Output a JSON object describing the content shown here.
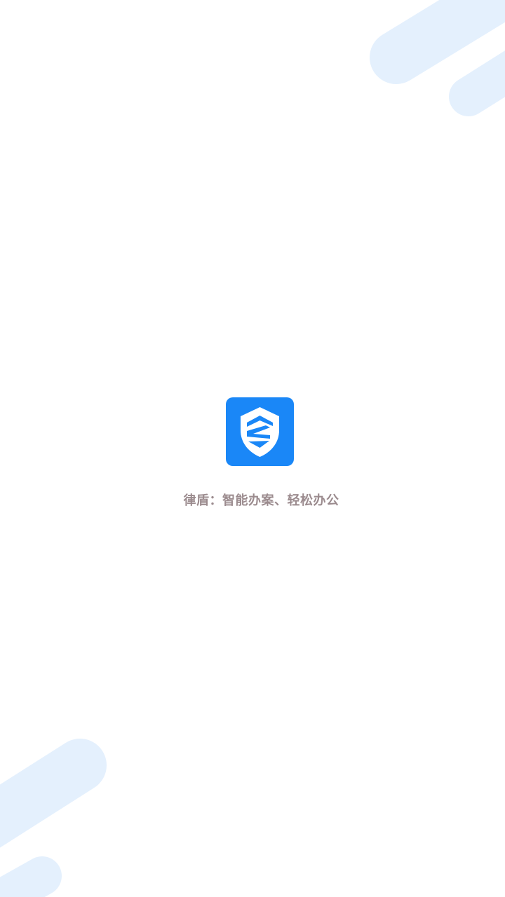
{
  "splash": {
    "tagline": "律盾：智能办案、轻松办公",
    "logo_icon": "shield-logo-icon",
    "brand_color": "#1a87f7",
    "tagline_color": "#9b8b8e",
    "decoration_color": "#e6f1fd"
  }
}
